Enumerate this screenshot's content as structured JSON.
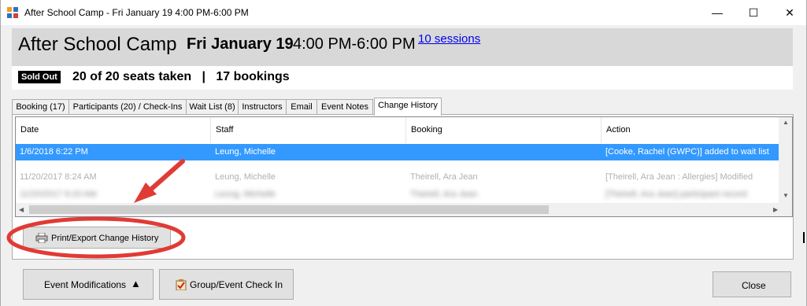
{
  "window": {
    "title": "After School Camp - Fri January 19 4:00 PM-6:00 PM",
    "minimize": "—",
    "maximize": "☐",
    "close": "✕"
  },
  "event": {
    "name": "After School Camp",
    "date": "Fri January 19",
    "time": "4:00 PM-6:00 PM",
    "sessions_link": "10 sessions",
    "badge": "Sold Out",
    "seats_summary": "20 of 20 seats taken   |   17 bookings"
  },
  "tabs": [
    {
      "label": "Booking (17)"
    },
    {
      "label": "Participants (20) / Check-Ins"
    },
    {
      "label": "Wait List (8)"
    },
    {
      "label": "Instructors"
    },
    {
      "label": "Email"
    },
    {
      "label": "Event Notes"
    },
    {
      "label": "Change History"
    }
  ],
  "history": {
    "columns": [
      "Date",
      "Staff",
      "Booking",
      "Action"
    ],
    "rows": [
      {
        "date": "1/6/2018 6:22 PM",
        "staff": "Leung, Michelle",
        "booking": "",
        "action": "[Cooke, Rachel (GWPC)] added to wait list"
      },
      {
        "date": "11/20/2017 8:24 AM",
        "staff": "Leung, Michelle",
        "booking": "Theirell, Ara Jean",
        "action": "[Theirell, Ara Jean : Allergies] Modified"
      },
      {
        "date": "11/20/2017 8:20 AM",
        "staff": "Leung, Michelle",
        "booking": "Theirell, Ara Jean",
        "action": "[Theirell, Ara Jean] participant record"
      }
    ]
  },
  "buttons": {
    "print_export": "Print/Export Change History",
    "event_modifications": "Event Modifications",
    "group_check_in": "Group/Event Check In",
    "close": "Close"
  },
  "colors": {
    "selection": "#3399ff",
    "annotation": "#e03b35",
    "link": "#0000ee"
  }
}
